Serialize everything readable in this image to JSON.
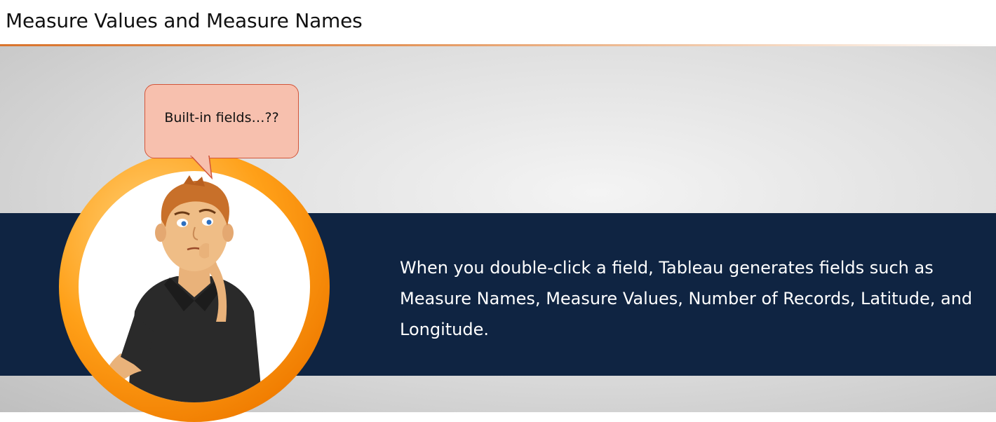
{
  "slide": {
    "title": "Measure Values and Measure Names",
    "bubble_text": "Built-in fields…??",
    "body_text": "When you double-click a field, Tableau generates fields such as Measure Names, Measure Values, Number of Records, Latitude, and Longitude."
  },
  "icons": {
    "character": "thinking-man-illustration"
  },
  "colors": {
    "band": "#0f2442",
    "ring": "#f08a00",
    "bubble": "#f7c0ae",
    "title_rule": "#d9742c"
  }
}
